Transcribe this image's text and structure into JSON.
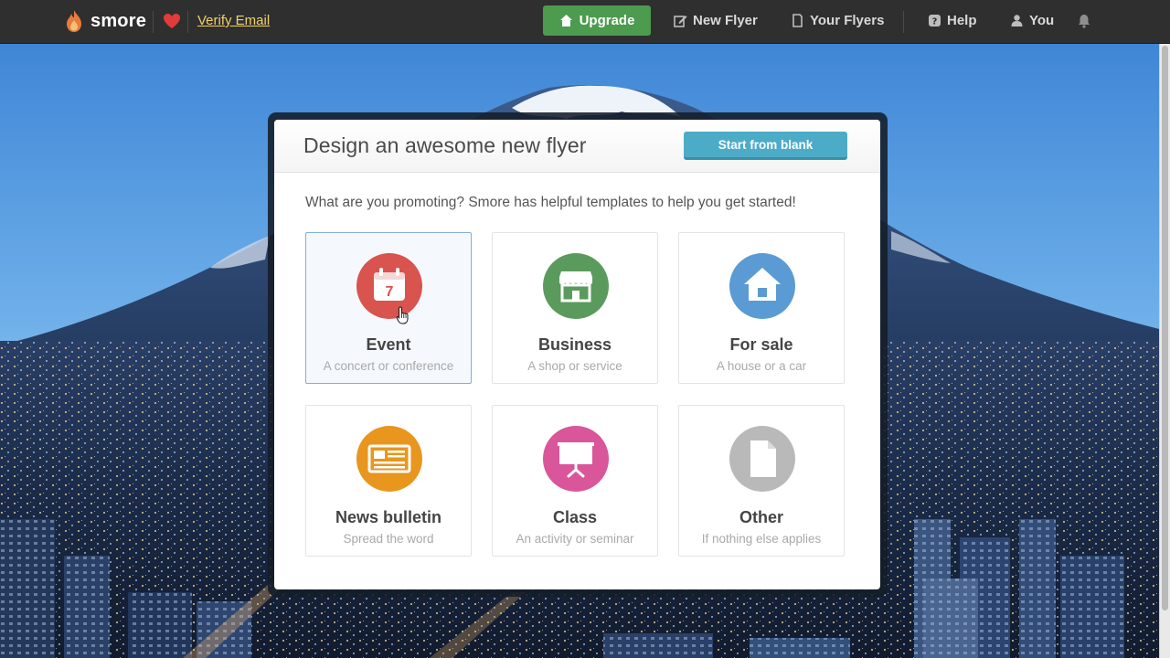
{
  "nav": {
    "brand": "smore",
    "verify_email": "Verify Email",
    "upgrade": "Upgrade",
    "new_flyer": "New Flyer",
    "your_flyers": "Your Flyers",
    "help": "Help",
    "you": "You"
  },
  "modal": {
    "title": "Design an awesome new flyer",
    "start_blank": "Start from blank",
    "prompt": "What are you promoting? Smore has helpful templates to help you get started!",
    "calendar_day": "7",
    "tiles": [
      {
        "title": "Event",
        "subtitle": "A concert or conference",
        "icon": "calendar-icon",
        "color": "#d9534f",
        "selected": true
      },
      {
        "title": "Business",
        "subtitle": "A shop or service",
        "icon": "storefront-icon",
        "color": "#5b9a5d",
        "selected": false
      },
      {
        "title": "For sale",
        "subtitle": "A house or a car",
        "icon": "house-icon",
        "color": "#5a9bd3",
        "selected": false
      },
      {
        "title": "News bulletin",
        "subtitle": "Spread the word",
        "icon": "newspaper-icon",
        "color": "#e8961e",
        "selected": false
      },
      {
        "title": "Class",
        "subtitle": "An activity or seminar",
        "icon": "presentation-board-icon",
        "color": "#d9569a",
        "selected": false
      },
      {
        "title": "Other",
        "subtitle": "If nothing else applies",
        "icon": "document-icon",
        "color": "#b9b9b9",
        "selected": false
      }
    ]
  },
  "colors": {
    "topbar": "#2f2f2f",
    "upgrade": "#4c9b4f",
    "start_blank": "#4cacc8",
    "verify_link": "#f0d268"
  }
}
